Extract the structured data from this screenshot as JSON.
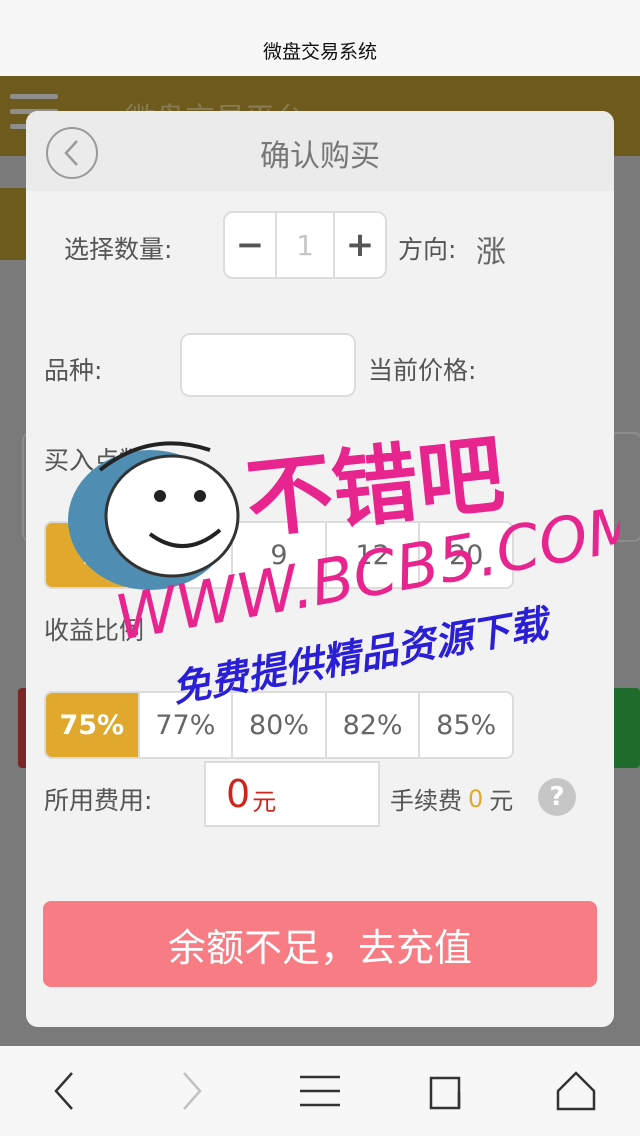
{
  "browser": {
    "title": "微盘交易系统"
  },
  "app": {
    "title": "微盘交易平台"
  },
  "modal": {
    "title": "确认购买",
    "quantity_label": "选择数量:",
    "minus": "−",
    "quantity_value": "1",
    "plus": "+",
    "direction_label": "方向:",
    "direction_value": "涨",
    "variety_label": "品种:",
    "current_price_label": "当前价格:",
    "points_label": "买入点数",
    "points_options": [
      "3",
      "6",
      "9",
      "12",
      "20"
    ],
    "points_selected_index": 0,
    "ratio_label": "收益比例",
    "ratio_options": [
      "75%",
      "77%",
      "80%",
      "82%",
      "85%"
    ],
    "ratio_selected_index": 0,
    "cost_label": "所用费用:",
    "cost_value": "0",
    "cost_unit": "元",
    "fee_label": "手续费",
    "fee_value": "0",
    "fee_unit": "元",
    "help_icon": "?",
    "submit_label": "余额不足，去充值"
  },
  "watermark": {
    "line1": "不错吧",
    "line2": "WWW.BCB5.COM",
    "line3": "免费提供精品资源下载"
  },
  "colors": {
    "accent": "#e0a92e",
    "submit": "#f77c83",
    "cost": "#d0241b",
    "watermark": "#e8258f"
  },
  "nav": {
    "icons": [
      "back-icon",
      "forward-icon",
      "menu-icon",
      "tabs-icon",
      "home-icon"
    ]
  }
}
